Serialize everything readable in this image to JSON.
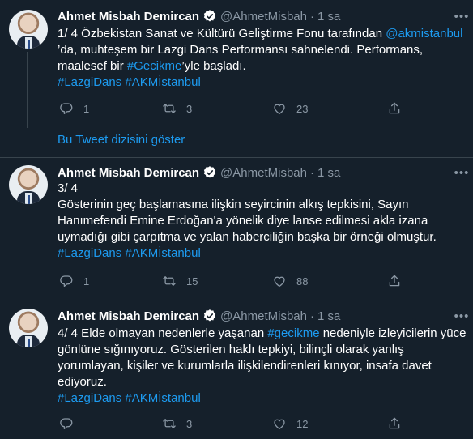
{
  "tweets": [
    {
      "name": "Ahmet Misbah Demircan",
      "handle": "@AhmetMisbah",
      "dot": "·",
      "time": "1 sa",
      "lines": [
        [
          {
            "t": "1/ 4 Özbekistan Sanat ve Kültürü Geliştirme Fonu tarafından "
          },
          {
            "t": "@akmistanbul",
            "link": true
          }
        ],
        [
          {
            "t": "’da, muhteşem bir Lazgi Dans Performansı sahnelendi. Performans,"
          }
        ],
        [
          {
            "t": "maalesef bir "
          },
          {
            "t": "#Gecikme",
            "link": true
          },
          {
            "t": "’yle başladı."
          }
        ],
        [
          {
            "t": "#LazgiDans #AKMİstanbul",
            "link": true
          }
        ]
      ],
      "replies": "1",
      "retweets": "3",
      "likes": "23"
    },
    {
      "name": "Ahmet Misbah Demircan",
      "handle": "@AhmetMisbah",
      "dot": "·",
      "time": "1 sa",
      "lines": [
        [
          {
            "t": "3/ 4"
          }
        ],
        [
          {
            "t": "Gösterinin geç başlamasına ilişkin seyircinin alkış tepkisini, Sayın"
          }
        ],
        [
          {
            "t": "Hanımefendi Emine Erdoğan'a yönelik diye lanse edilmesi akla izana"
          }
        ],
        [
          {
            "t": "uymadığı gibi çarpıtma ve yalan haberciliğin başka bir örneği olmuştur."
          }
        ],
        [
          {
            "t": "#LazgiDans #AKMİstanbul",
            "link": true
          }
        ]
      ],
      "replies": "1",
      "retweets": "15",
      "likes": "88"
    },
    {
      "name": "Ahmet Misbah Demircan",
      "handle": "@AhmetMisbah",
      "dot": "·",
      "time": "1 sa",
      "lines": [
        [
          {
            "t": "4/ 4 Elde olmayan nedenlerle yaşanan "
          },
          {
            "t": "#gecikme",
            "link": true
          },
          {
            "t": " nedeniyle izleyicilerin yüce"
          }
        ],
        [
          {
            "t": "gönlüne sığınıyoruz. Gösterilen haklı tepkiyi, bilinçli olarak yanlış"
          }
        ],
        [
          {
            "t": "yorumlayan, kişiler ve kurumlarla ilişkilendirenleri kınıyor, insafa davet"
          }
        ],
        [
          {
            "t": "ediyoruz."
          }
        ],
        [
          {
            "t": "#LazgiDans #AKMİstanbul",
            "link": true
          }
        ]
      ],
      "replies": "",
      "retweets": "3",
      "likes": "12"
    }
  ],
  "show_thread": "Bu Tweet dizisini göster",
  "colors": {
    "background": "#15202b",
    "link": "#1d9bf0",
    "muted": "#8b98a5",
    "border": "#38444d"
  },
  "icons": [
    "verified-badge-icon",
    "more-icon",
    "reply-icon",
    "retweet-icon",
    "like-icon",
    "share-icon"
  ]
}
